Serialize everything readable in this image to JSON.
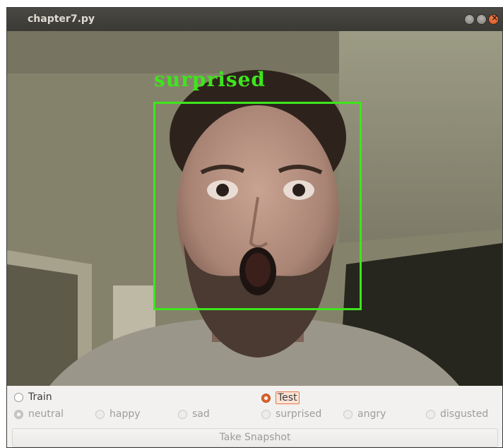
{
  "window": {
    "title": "chapter7.py"
  },
  "overlay": {
    "label": "surprised",
    "box_color": "#3ee51c"
  },
  "mode": {
    "train_label": "Train",
    "test_label": "Test",
    "selected": "Test"
  },
  "emotions": [
    {
      "label": "neutral",
      "selected": true
    },
    {
      "label": "happy",
      "selected": false
    },
    {
      "label": "sad",
      "selected": false
    },
    {
      "label": "surprised",
      "selected": false
    },
    {
      "label": "angry",
      "selected": false
    },
    {
      "label": "disgusted",
      "selected": false
    }
  ],
  "snapshot_button": "Take Snapshot",
  "colors": {
    "accent": "#e1622a",
    "titlebar": "#3f3e3a",
    "detect": "#3ee51c"
  }
}
